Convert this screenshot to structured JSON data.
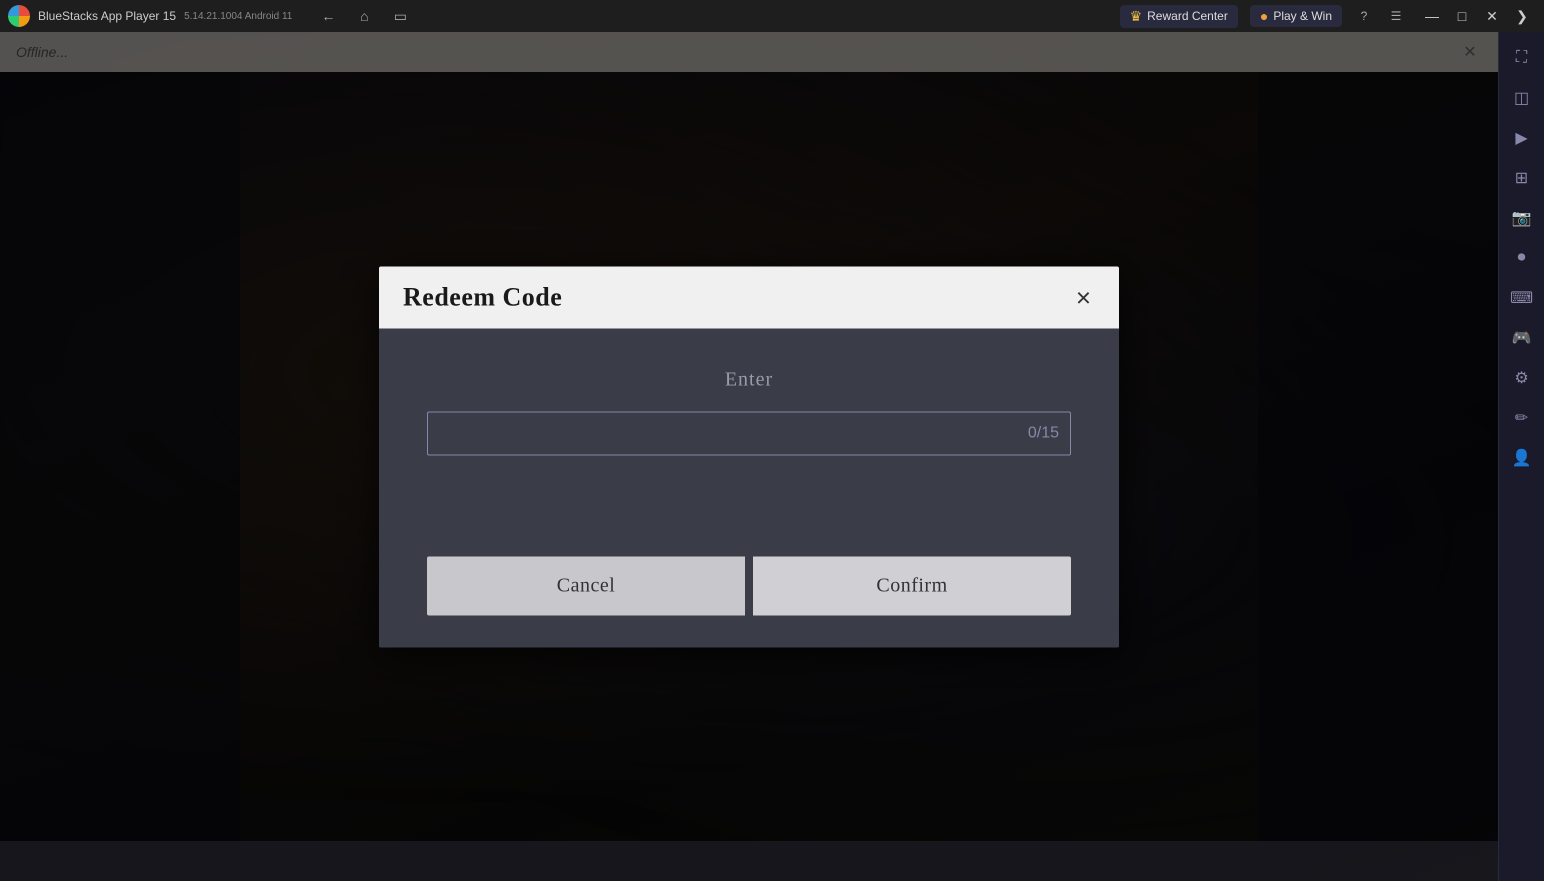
{
  "titlebar": {
    "app_name": "BlueStacks App Player 15",
    "version": "5.14.21.1004  Android 11",
    "reward_center_label": "Reward Center",
    "play_win_label": "Play & Win"
  },
  "sidebar": {
    "icons": [
      {
        "name": "expand-icon",
        "glyph": "⛶"
      },
      {
        "name": "layers-icon",
        "glyph": "◫"
      },
      {
        "name": "media-icon",
        "glyph": "▶"
      },
      {
        "name": "grid-icon",
        "glyph": "⊞"
      },
      {
        "name": "camera-icon",
        "glyph": "⊡"
      },
      {
        "name": "record-icon",
        "glyph": "◉"
      },
      {
        "name": "keyboard-icon",
        "glyph": "⌨"
      },
      {
        "name": "gamepad-icon",
        "glyph": "🎮"
      },
      {
        "name": "settings-icon",
        "glyph": "⚙"
      },
      {
        "name": "brush-icon",
        "glyph": "✏"
      },
      {
        "name": "user-icon",
        "glyph": "👤"
      }
    ]
  },
  "modal": {
    "title": "Redeem Code",
    "close_label": "×",
    "enter_label": "Enter",
    "input_placeholder": "",
    "input_counter": "0/15",
    "cancel_label": "Cancel",
    "confirm_label": "Confirm"
  },
  "game_topbar": {
    "title": "Offline..."
  }
}
